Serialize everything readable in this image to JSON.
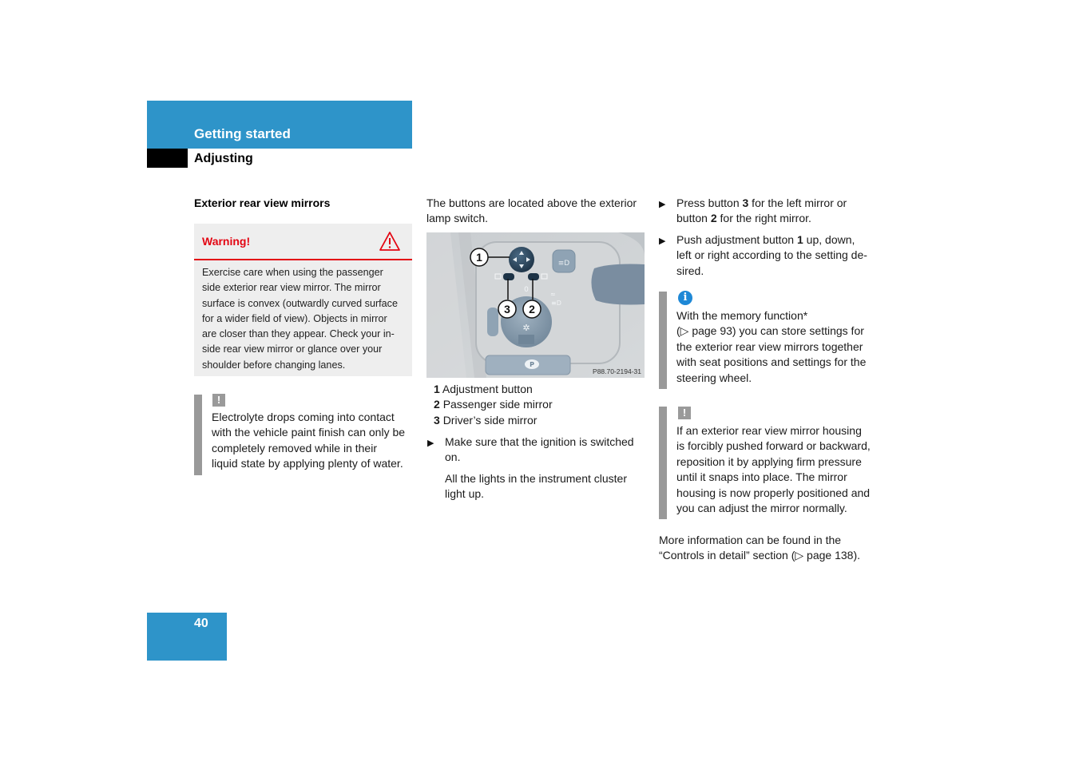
{
  "header": {
    "chapter": "Getting started",
    "section": "Adjusting"
  },
  "page_number": "40",
  "left_column": {
    "subheading": "Exterior rear view mirrors",
    "warning": {
      "label": "Warning!",
      "icon": "warning-triangle-icon",
      "lines": [
        "Exercise care when using the passenger",
        "side exterior rear view mirror. The mirror",
        "surface is convex (outwardly curved surface",
        "for a wider field of view). Objects in mirror",
        "are closer than they appear. Check your in-",
        "side rear view mirror or glance over your",
        "shoulder before changing lanes."
      ]
    },
    "note": {
      "icon": "exclamation-icon",
      "icon_glyph": "!",
      "lines": [
        "Electrolyte drops coming into contact",
        "with the vehicle paint finish can only be",
        "completely removed while in their",
        "liquid state by applying plenty of water."
      ]
    }
  },
  "middle_column": {
    "intro_lines": [
      "The buttons are located above the exterior",
      "lamp switch."
    ],
    "figure": {
      "callouts": [
        "1",
        "2",
        "3"
      ],
      "code": "P88.70-2194-31"
    },
    "legend": [
      {
        "num": "1",
        "text": "Adjustment button"
      },
      {
        "num": "2",
        "text": "Passenger side mirror"
      },
      {
        "num": "3",
        "text": "Driver’s side mirror"
      }
    ],
    "step": {
      "bullet": "▶",
      "lines": [
        "Make sure that the ignition is switched",
        "on."
      ]
    },
    "result_lines": [
      "All the lights in the instrument cluster",
      "light up."
    ]
  },
  "right_column": {
    "steps": [
      {
        "parts": [
          {
            "t": "Press button ",
            "b": false
          },
          {
            "t": "3",
            "b": true
          },
          {
            "t": " for the left mirror or",
            "b": false
          }
        ],
        "line2": [
          {
            "t": "button ",
            "b": false
          },
          {
            "t": "2",
            "b": true
          },
          {
            "t": " for the right mirror.",
            "b": false
          }
        ]
      },
      {
        "parts": [
          {
            "t": "Push adjustment button ",
            "b": false
          },
          {
            "t": "1",
            "b": true
          },
          {
            "t": " up, down,",
            "b": false
          }
        ],
        "line2": [
          {
            "t": "left or right according to the setting de-",
            "b": false
          }
        ],
        "line3": "sired."
      }
    ],
    "info": {
      "icon": "info-icon",
      "icon_glyph": "i",
      "lines": [
        "With the memory function*",
        "(▷ page 93) you can store settings for",
        "the exterior rear view mirrors together",
        "with seat positions and settings for the",
        "steering wheel."
      ]
    },
    "note": {
      "icon": "exclamation-icon",
      "icon_glyph": "!",
      "lines": [
        "If an exterior rear view mirror housing",
        "is forcibly pushed forward or backward,",
        "reposition it by applying firm pressure",
        "until it snaps into place. The mirror",
        "housing is now properly positioned and",
        "you can adjust the mirror normally."
      ]
    },
    "more_info_lines": [
      "More information can be found in the",
      "“Controls in detail” section (▷ page 138)."
    ]
  }
}
